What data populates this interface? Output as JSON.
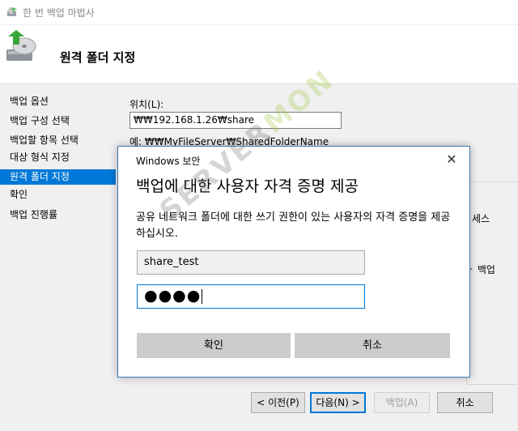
{
  "window": {
    "title": "한 번 백업 마법사"
  },
  "header": {
    "title": "원격 폴더 지정"
  },
  "sidebar": {
    "items": [
      {
        "label": "백업 옵션",
        "active": false
      },
      {
        "label": "백업 구성 선택",
        "active": false
      },
      {
        "label": "백업할 항목 선택",
        "active": false
      },
      {
        "label": "대상 형식 지정",
        "active": false
      },
      {
        "label": "원격 폴더 지정",
        "active": true
      },
      {
        "label": "확인",
        "active": false
      },
      {
        "label": "백업 진행률",
        "active": false
      }
    ]
  },
  "main": {
    "location_label": "위치(L):",
    "location_value": "₩₩192.168.1.26₩share",
    "example": "예: ₩₩MyFileServer₩SharedFolderName",
    "background_text_1": "세스",
    "background_text_2": "ㅏ 백업"
  },
  "buttons": {
    "prev": "< 이전(P)",
    "next": "다음(N) >",
    "backup": "백업(A)",
    "cancel": "취소"
  },
  "dialog": {
    "title": "Windows 보안",
    "close": "✕",
    "heading": "백업에 대한 사용자 자격 증명 제공",
    "message": "공유 네트워크 폴더에 대한 쓰기 권한이 있는 사용자의 자격 증명을 제공하십시오.",
    "username": "share_test",
    "password_mask": "●●●●",
    "ok": "확인",
    "cancel": "취소"
  },
  "watermark": {
    "part1": "SERVER",
    "part2": "MON"
  },
  "colors": {
    "accent": "#0078d7",
    "sidebar_bg": "#f0f0f0",
    "dialog_border": "#3b79b0"
  }
}
